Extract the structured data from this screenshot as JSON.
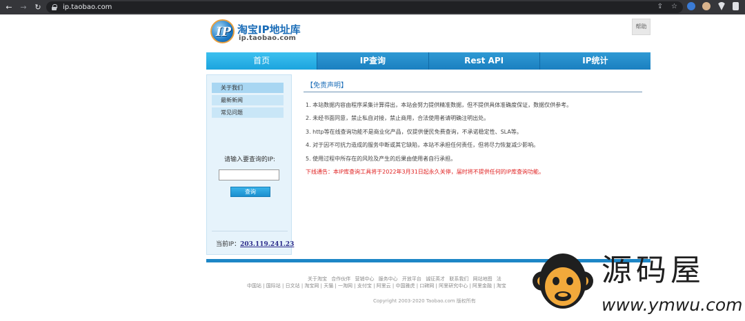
{
  "browser": {
    "url": "ip.taobao.com",
    "back_icon": "back-arrow-icon",
    "forward_icon": "forward-arrow-icon",
    "reload_icon": "reload-icon",
    "lock_icon": "lock-icon",
    "share_icon": "share-icon",
    "bookmark_icon": "star-icon"
  },
  "header": {
    "logo_title": "淘宝IP地址库",
    "logo_subtitle": "ip.taobao.com",
    "help_label": "帮助"
  },
  "nav": {
    "tabs": [
      {
        "label": "首页",
        "active": true
      },
      {
        "label": "IP查询",
        "active": false
      },
      {
        "label": "Rest API",
        "active": false
      },
      {
        "label": "IP统计",
        "active": false
      }
    ]
  },
  "sidebar": {
    "items": [
      {
        "label": "关于我们"
      },
      {
        "label": "最新新闻"
      },
      {
        "label": "常见问题"
      }
    ],
    "ip_prompt": "请输入要查询的IP:",
    "ip_input_value": "",
    "query_button": "查询",
    "current_ip_label": "当前IP：",
    "current_ip_value": "203.119.241.23"
  },
  "main": {
    "title": "【免责声明】",
    "lines": [
      "1. 本站数据内容由程序采集计算得出，本站会努力提供精准数据，但不提供具体准确度保证，数据仅供参考。",
      "2. 未经书面同意，禁止私自对接，禁止商用，合法使用者请明确注明出处。",
      "3. http等在线查询功能不是商业化产品，仅提供便民免费查询，不承诺稳定性、SLA等。",
      "4. 对于因不可抗力造成的服务中断或其它缺陷，本站不承担任何责任，但将尽力恢复减少影响。",
      "5. 使用过程中所存在的风险及产生的后果由使用者自行承担。"
    ],
    "notice": "下线通告：本IP库查询工具将于2022年3月31日起永久关停，届时将不提供任何的IP库查询功能。"
  },
  "footer": {
    "links_row1": "关于淘宝 合作伙伴 营销中心 服务中心 开放平台 诚征英才 联系我们 网站地图 法",
    "links_row2": "中国站 | 国际站 | 日文站 | 淘宝网 | 天猫 | 一淘网 | 支付宝 | 阿里云 | 中国雅虎 | 口碑网 | 阿里研究中心 | 阿里金融 | 淘宝",
    "copyright": "Copyright 2003-2020 Taobao.com 版权所有"
  },
  "watermark": {
    "cn": "源码屋",
    "en": "www.ymwu.com",
    "icon": "monkey-logo-icon"
  },
  "colors": {
    "nav_blue": "#1a7fc0",
    "nav_active": "#1ca4de",
    "notice_red": "#e02020",
    "sidebar_bg": "#e6f3fb"
  }
}
